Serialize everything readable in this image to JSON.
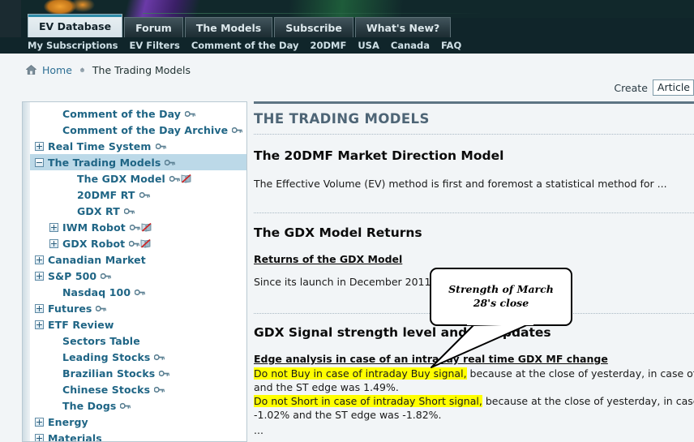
{
  "header": {
    "banner_name": "site-banner-image",
    "tabs": [
      {
        "label": "EV Database",
        "active": true
      },
      {
        "label": "Forum",
        "active": false
      },
      {
        "label": "The Models",
        "active": false
      },
      {
        "label": "Subscribe",
        "active": false
      },
      {
        "label": "What's New?",
        "active": false
      }
    ],
    "subnav": [
      "My Subscriptions",
      "EV Filters",
      "Comment of the Day",
      "20DMF",
      "USA",
      "Canada",
      "FAQ"
    ]
  },
  "breadcrumb": {
    "home": "Home",
    "current": "The Trading Models"
  },
  "create": {
    "label": "Create",
    "selected": "Article"
  },
  "sidebar": {
    "items": [
      {
        "label": "Comment of the Day",
        "indent": 1,
        "toggle": "none",
        "key": true,
        "book": false,
        "selected": false
      },
      {
        "label": "Comment of the Day Archive",
        "indent": 1,
        "toggle": "none",
        "key": true,
        "book": false,
        "selected": false
      },
      {
        "label": "Real Time System",
        "indent": 0,
        "toggle": "plus",
        "key": true,
        "book": false,
        "selected": false
      },
      {
        "label": "The Trading Models",
        "indent": 0,
        "toggle": "minus",
        "key": true,
        "book": false,
        "selected": true
      },
      {
        "label": "The GDX Model",
        "indent": 2,
        "toggle": "none",
        "key": true,
        "book": true,
        "selected": false
      },
      {
        "label": "20DMF RT",
        "indent": 2,
        "toggle": "none",
        "key": true,
        "book": false,
        "selected": false
      },
      {
        "label": "GDX RT",
        "indent": 2,
        "toggle": "none",
        "key": true,
        "book": false,
        "selected": false
      },
      {
        "label": "IWM Robot",
        "indent": 1,
        "toggle": "plus",
        "key": true,
        "book": true,
        "selected": false
      },
      {
        "label": "GDX Robot",
        "indent": 1,
        "toggle": "plus",
        "key": true,
        "book": true,
        "selected": false
      },
      {
        "label": "Canadian Market",
        "indent": 0,
        "toggle": "plus",
        "key": false,
        "book": false,
        "selected": false
      },
      {
        "label": "S&P 500",
        "indent": 0,
        "toggle": "plus",
        "key": true,
        "book": false,
        "selected": false
      },
      {
        "label": "Nasdaq 100",
        "indent": 1,
        "toggle": "none",
        "key": true,
        "book": false,
        "selected": false
      },
      {
        "label": "Futures",
        "indent": 0,
        "toggle": "plus",
        "key": true,
        "book": false,
        "selected": false
      },
      {
        "label": "ETF Review",
        "indent": 0,
        "toggle": "plus",
        "key": false,
        "book": false,
        "selected": false
      },
      {
        "label": "Sectors Table",
        "indent": 1,
        "toggle": "none",
        "key": false,
        "book": false,
        "selected": false
      },
      {
        "label": "Leading Stocks",
        "indent": 1,
        "toggle": "none",
        "key": true,
        "book": false,
        "selected": false
      },
      {
        "label": "Brazilian Stocks",
        "indent": 1,
        "toggle": "none",
        "key": true,
        "book": false,
        "selected": false
      },
      {
        "label": "Chinese Stocks",
        "indent": 1,
        "toggle": "none",
        "key": true,
        "book": false,
        "selected": false
      },
      {
        "label": "The Dogs",
        "indent": 1,
        "toggle": "none",
        "key": true,
        "book": false,
        "selected": false
      },
      {
        "label": "Energy",
        "indent": 0,
        "toggle": "plus",
        "key": false,
        "book": false,
        "selected": false
      },
      {
        "label": "Materials",
        "indent": 0,
        "toggle": "plus",
        "key": false,
        "book": false,
        "selected": false
      }
    ]
  },
  "main": {
    "page_title": "THE TRADING MODELS",
    "section1": {
      "title": "The 20DMF Market Direction Model",
      "body": "The Effective Volume (EV) method is first and foremost a statistical method for ..."
    },
    "section2": {
      "title": "The GDX Model Returns",
      "subtitle": "Returns of the GDX Model",
      "body": "Since its launch in December 2011, as o"
    },
    "section3": {
      "title": "GDX Signal strength level and RT updates",
      "subtitle": "Edge analysis in case of an intraday real time GDX MF change",
      "line1_hl": "Do not Buy in case of intraday Buy signal,",
      "line1_rest": " because at the close of yesterday, in case of a Buy signal",
      "line2": "and the ST edge was 1.49%.",
      "line3_hl": "Do not Short in case of intraday Short signal,",
      "line3_rest": " because at the close of yesterday, in case of a Short",
      "line4": "-1.02% and the ST edge was -1.82%.",
      "line5": "..."
    }
  },
  "callout": {
    "text": "Strength of March 28's close"
  }
}
